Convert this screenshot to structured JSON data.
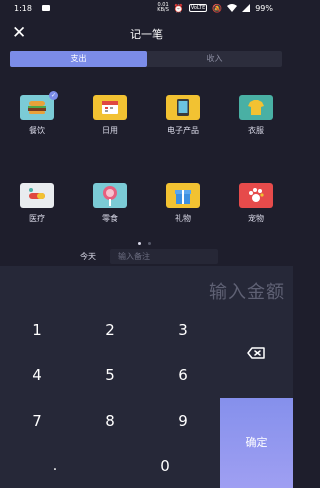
{
  "status_bar": {
    "time": "1:18",
    "speed_top": "0.01",
    "speed_bottom": "KB/S",
    "volte": "VoLTE",
    "battery": "99%"
  },
  "header": {
    "title": "记一笔"
  },
  "tabs": {
    "expense": "支出",
    "income": "收入"
  },
  "categories": [
    {
      "label": "餐饮",
      "icon": "burger-icon",
      "color": "#7bcbd6",
      "selected": true
    },
    {
      "label": "日用",
      "icon": "calendar-icon",
      "color": "#f2c232",
      "selected": false
    },
    {
      "label": "电子产品",
      "icon": "tablet-icon",
      "color": "#f2c232",
      "selected": false
    },
    {
      "label": "衣服",
      "icon": "shirt-icon",
      "color": "#49b0a4",
      "selected": false
    },
    {
      "label": "医疗",
      "icon": "pill-icon",
      "color": "#e9ecef",
      "selected": false
    },
    {
      "label": "零食",
      "icon": "lollipop-icon",
      "color": "#7bcbd6",
      "selected": false
    },
    {
      "label": "礼物",
      "icon": "gift-icon",
      "color": "#f2c232",
      "selected": false
    },
    {
      "label": "宠物",
      "icon": "paw-icon",
      "color": "#e64b4b",
      "selected": false
    }
  ],
  "pager": {
    "pages": 2,
    "current": 1
  },
  "note_row": {
    "date": "今天",
    "note_placeholder": "输入备注"
  },
  "keypad": {
    "amount_placeholder": "输入金额",
    "keys": [
      "1",
      "2",
      "3",
      "4",
      "5",
      "6",
      "7",
      "8",
      "9",
      ".",
      "0"
    ],
    "confirm": "确定"
  },
  "colors": {
    "accent": "#7b8ce8",
    "background": "#1e1e2c",
    "keypad_background": "#262838"
  }
}
